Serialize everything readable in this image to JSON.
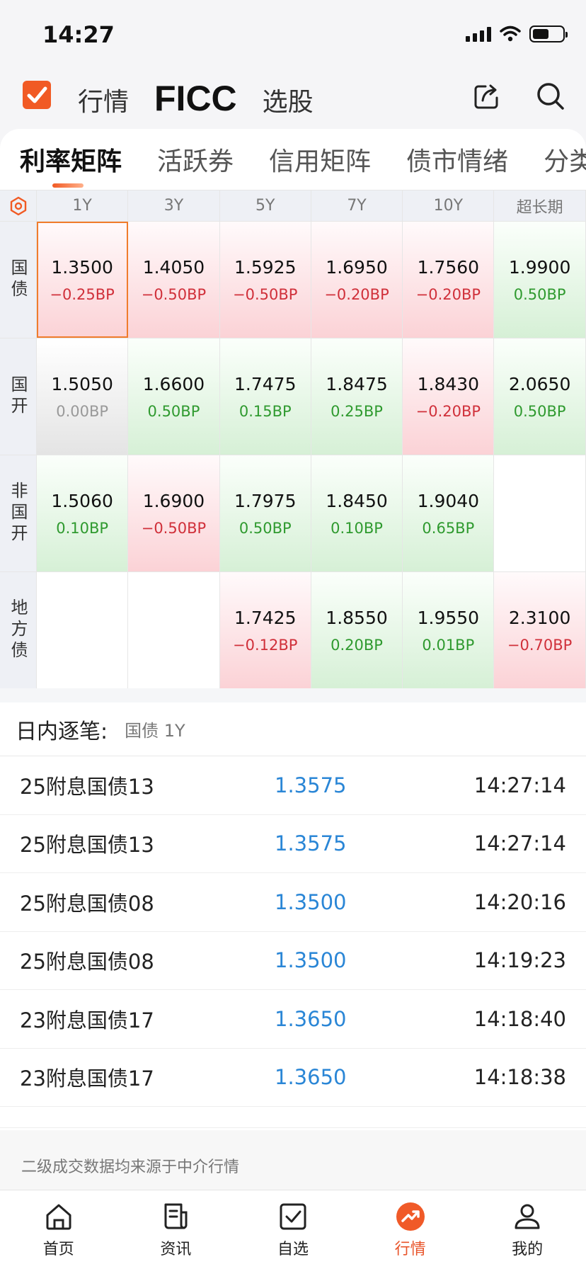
{
  "status_bar": {
    "time": "14:27"
  },
  "header": {
    "nav": [
      "行情",
      "FICC",
      "选股"
    ],
    "active_index": 1
  },
  "tabs": [
    "利率矩阵",
    "活跃券",
    "信用矩阵",
    "债市情绪",
    "分类"
  ],
  "matrix": {
    "columns": [
      "1Y",
      "3Y",
      "5Y",
      "7Y",
      "10Y",
      "超长期"
    ],
    "rows": [
      {
        "label": "国债",
        "cells": [
          {
            "value": "1.3500",
            "change": "−0.25BP",
            "dir": "up",
            "selected": true
          },
          {
            "value": "1.4050",
            "change": "−0.50BP",
            "dir": "up"
          },
          {
            "value": "1.5925",
            "change": "−0.50BP",
            "dir": "up"
          },
          {
            "value": "1.6950",
            "change": "−0.20BP",
            "dir": "up"
          },
          {
            "value": "1.7560",
            "change": "−0.20BP",
            "dir": "up"
          },
          {
            "value": "1.9900",
            "change": "0.50BP",
            "dir": "down"
          }
        ]
      },
      {
        "label": "国开",
        "cells": [
          {
            "value": "1.5050",
            "change": "0.00BP",
            "dir": "flat"
          },
          {
            "value": "1.6600",
            "change": "0.50BP",
            "dir": "down"
          },
          {
            "value": "1.7475",
            "change": "0.15BP",
            "dir": "down"
          },
          {
            "value": "1.8475",
            "change": "0.25BP",
            "dir": "down"
          },
          {
            "value": "1.8430",
            "change": "−0.20BP",
            "dir": "up"
          },
          {
            "value": "2.0650",
            "change": "0.50BP",
            "dir": "down"
          }
        ]
      },
      {
        "label": "非国开",
        "cells": [
          {
            "value": "1.5060",
            "change": "0.10BP",
            "dir": "down"
          },
          {
            "value": "1.6900",
            "change": "−0.50BP",
            "dir": "up"
          },
          {
            "value": "1.7975",
            "change": "0.50BP",
            "dir": "down"
          },
          {
            "value": "1.8450",
            "change": "0.10BP",
            "dir": "down"
          },
          {
            "value": "1.9040",
            "change": "0.65BP",
            "dir": "down"
          },
          {
            "value": "",
            "change": "",
            "dir": "empty"
          }
        ]
      },
      {
        "label": "地方债",
        "cells": [
          {
            "value": "",
            "change": "",
            "dir": "empty"
          },
          {
            "value": "",
            "change": "",
            "dir": "empty"
          },
          {
            "value": "1.7425",
            "change": "−0.12BP",
            "dir": "up"
          },
          {
            "value": "1.8550",
            "change": "0.20BP",
            "dir": "down"
          },
          {
            "value": "1.9550",
            "change": "0.01BP",
            "dir": "down"
          },
          {
            "value": "2.3100",
            "change": "−0.70BP",
            "dir": "up"
          }
        ]
      }
    ]
  },
  "intraday": {
    "title": "日内逐笔:",
    "subtitle": "国债 1Y",
    "trades": [
      {
        "name": "25附息国债13",
        "price": "1.3575",
        "time": "14:27:14"
      },
      {
        "name": "25附息国债13",
        "price": "1.3575",
        "time": "14:27:14"
      },
      {
        "name": "25附息国债08",
        "price": "1.3500",
        "time": "14:20:16"
      },
      {
        "name": "25附息国债08",
        "price": "1.3500",
        "time": "14:19:23"
      },
      {
        "name": "23附息国债17",
        "price": "1.3650",
        "time": "14:18:40"
      },
      {
        "name": "23附息国债17",
        "price": "1.3650",
        "time": "14:18:38"
      }
    ],
    "note": "二级成交数据均来源于中介行情"
  },
  "bottom_nav": [
    {
      "label": "首页",
      "icon": "home-icon"
    },
    {
      "label": "资讯",
      "icon": "news-icon"
    },
    {
      "label": "自选",
      "icon": "checkbox-icon"
    },
    {
      "label": "行情",
      "icon": "market-icon",
      "active": true
    },
    {
      "label": "我的",
      "icon": "profile-icon"
    }
  ],
  "colors": {
    "accent": "#f15a24",
    "up_red": "#d0303a",
    "down_green": "#2f9a2f",
    "price_blue": "#2a86d6"
  }
}
